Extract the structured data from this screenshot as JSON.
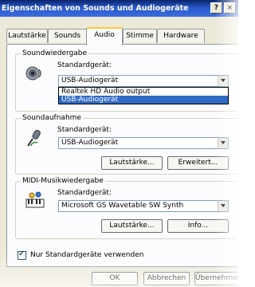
{
  "window": {
    "title": "Eigenschaften von Sounds und Audiogeräte",
    "help_button": "?",
    "close_button": "×"
  },
  "tabs": [
    {
      "label": "Lautstärke"
    },
    {
      "label": "Sounds"
    },
    {
      "label": "Audio",
      "active": true
    },
    {
      "label": "Stimme"
    },
    {
      "label": "Hardware"
    }
  ],
  "playback": {
    "group_title": "Soundwiedergabe",
    "device_label": "Standardgerät:",
    "selected": "USB-Audiogerät",
    "options": [
      "Realtek HD Audio output",
      "USB-Audiogerät"
    ],
    "highlighted_option": "USB-Audiogerät"
  },
  "recording": {
    "group_title": "Soundaufnahme",
    "device_label": "Standardgerät:",
    "selected": "USB-Audiogerät",
    "volume_button": "Lautstärke...",
    "advanced_button": "Erweitert..."
  },
  "midi": {
    "group_title": "MIDI-Musikwiedergabe",
    "device_label": "Standardgerät:",
    "selected": "Microsoft GS Wavetable SW Synth",
    "volume_button": "Lautstärke...",
    "info_button": "Info..."
  },
  "checkbox": {
    "label": "Nur Standardgeräte verwenden",
    "checked": true
  },
  "footer": {
    "ok": "OK",
    "cancel": "Abbrechen",
    "apply": "Übernehmen"
  },
  "colors": {
    "titlebar": "#0a246a",
    "selection": "#316ac5",
    "dialog_bg": "#ece9d8"
  }
}
